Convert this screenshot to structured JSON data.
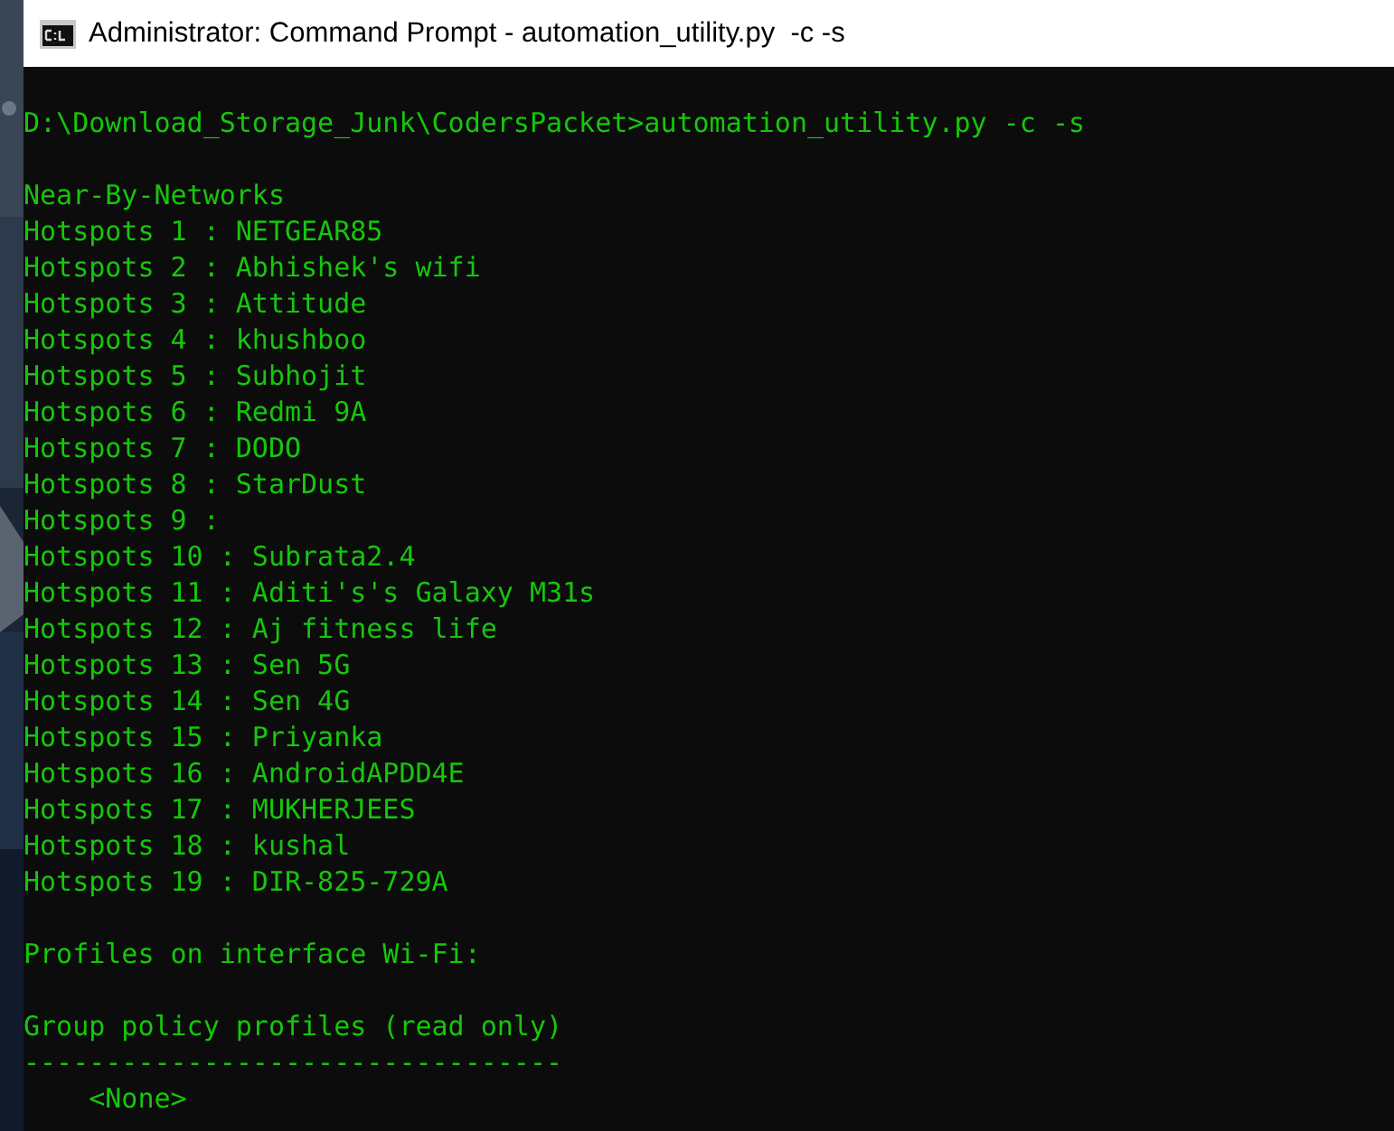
{
  "window": {
    "title": "Administrator: Command Prompt - automation_utility.py  -c -s"
  },
  "console": {
    "command": "D:\\Download_Storage_Junk\\CodersPacket>automation_utility.py -c -s",
    "heading": "Near-By-Networks",
    "hotspots": [
      "Hotspots 1 : NETGEAR85",
      "Hotspots 2 : Abhishek's wifi",
      "Hotspots 3 : Attitude",
      "Hotspots 4 : khushboo",
      "Hotspots 5 : Subhojit",
      "Hotspots 6 : Redmi 9A",
      "Hotspots 7 : DODO",
      "Hotspots 8 : StarDust",
      "Hotspots 9 :",
      "Hotspots 10 : Subrata2.4",
      "Hotspots 11 : Aditi's's Galaxy M31s",
      "Hotspots 12 : Aj fitness life",
      "Hotspots 13 : Sen 5G",
      "Hotspots 14 : Sen 4G",
      "Hotspots 15 : Priyanka",
      "Hotspots 16 : AndroidAPDD4E",
      "Hotspots 17 : MUKHERJEES",
      "Hotspots 18 : kushal",
      "Hotspots 19 : DIR-825-729A"
    ],
    "profiles_heading": "Profiles on interface Wi-Fi:",
    "group_heading": "Group policy profiles (read only)",
    "separator": "---------------------------------",
    "entry": "<None>"
  }
}
